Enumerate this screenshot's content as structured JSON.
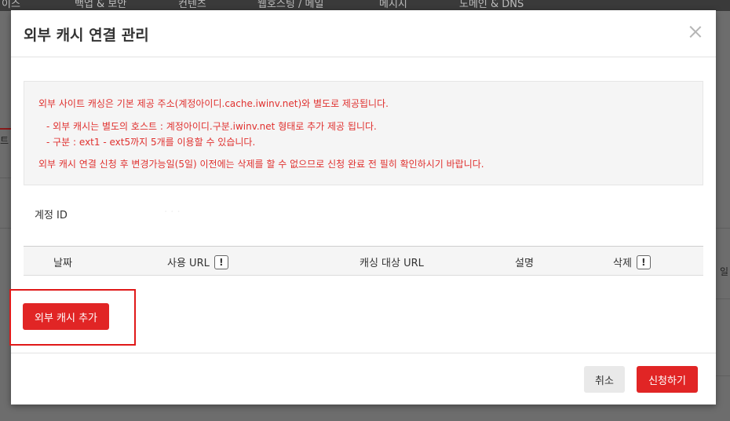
{
  "background": {
    "nav_items": [
      "이스",
      "백업 & 보안",
      "컨텐츠",
      "웹호스팅 / 메일",
      "메시지",
      "도메인 & DNS"
    ],
    "left_edge_text": "트",
    "right_edge_text": "일"
  },
  "modal": {
    "title": "외부 캐시 연결 관리",
    "close_icon": "close-icon",
    "notice": {
      "line1": "외부 사이트 캐싱은 기본 제공 주소(계정아이디.cache.iwinv.net)와 별도로 제공됩니다.",
      "line2": "- 외부 캐시는 별도의 호스트 : 계정아이디.구분.iwinv.net 형태로 추가 제공 됩니다.",
      "line3": "- 구분 : ext1 - ext5까지 5개를 이용할 수 있습니다.",
      "line4": "외부 캐시 연결 신청 후 변경가능일(5일) 이전에는 삭제를 할 수 없으므로 신청 완료 전 필히 확인하시기 바랍니다.",
      "color": "#e0312f"
    },
    "account_label": "계정 ID",
    "account_value": "·  ·  ·",
    "table": {
      "headers": [
        "날짜",
        "사용 URL",
        "캐싱 대상 URL",
        "설명",
        "삭제"
      ],
      "info_icon_glyph": "!"
    },
    "add_button": "외부 캐시 추가",
    "cancel_button": "취소",
    "submit_button": "신청하기",
    "accent_color": "#e12525"
  }
}
